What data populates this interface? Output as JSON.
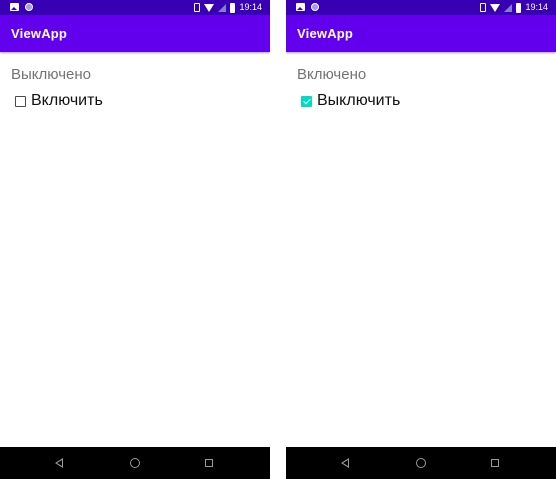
{
  "colors": {
    "status_bar": "#3700b3",
    "app_bar": "#6200ee",
    "accent": "#03dac5",
    "status_text": "#737373",
    "nav_bar": "#000000"
  },
  "screens": [
    {
      "status_bar": {
        "time": "19:14",
        "icons": [
          "image-icon",
          "notification-dot-icon",
          "vibrate-icon",
          "wifi-icon",
          "no-signal-icon",
          "battery-icon"
        ]
      },
      "app_bar": {
        "title": "ViewApp"
      },
      "status_text": "Выключено",
      "checkbox": {
        "label": "Включить",
        "checked": false
      },
      "nav_bar": {
        "icons": [
          "back-icon",
          "home-icon",
          "recents-icon"
        ]
      }
    },
    {
      "status_bar": {
        "time": "19:14",
        "icons": [
          "image-icon",
          "notification-dot-icon",
          "vibrate-icon",
          "wifi-icon",
          "no-signal-icon",
          "battery-icon"
        ]
      },
      "app_bar": {
        "title": "ViewApp"
      },
      "status_text": "Включено",
      "checkbox": {
        "label": "Выключить",
        "checked": true
      },
      "nav_bar": {
        "icons": [
          "back-icon",
          "home-icon",
          "recents-icon"
        ]
      }
    }
  ]
}
